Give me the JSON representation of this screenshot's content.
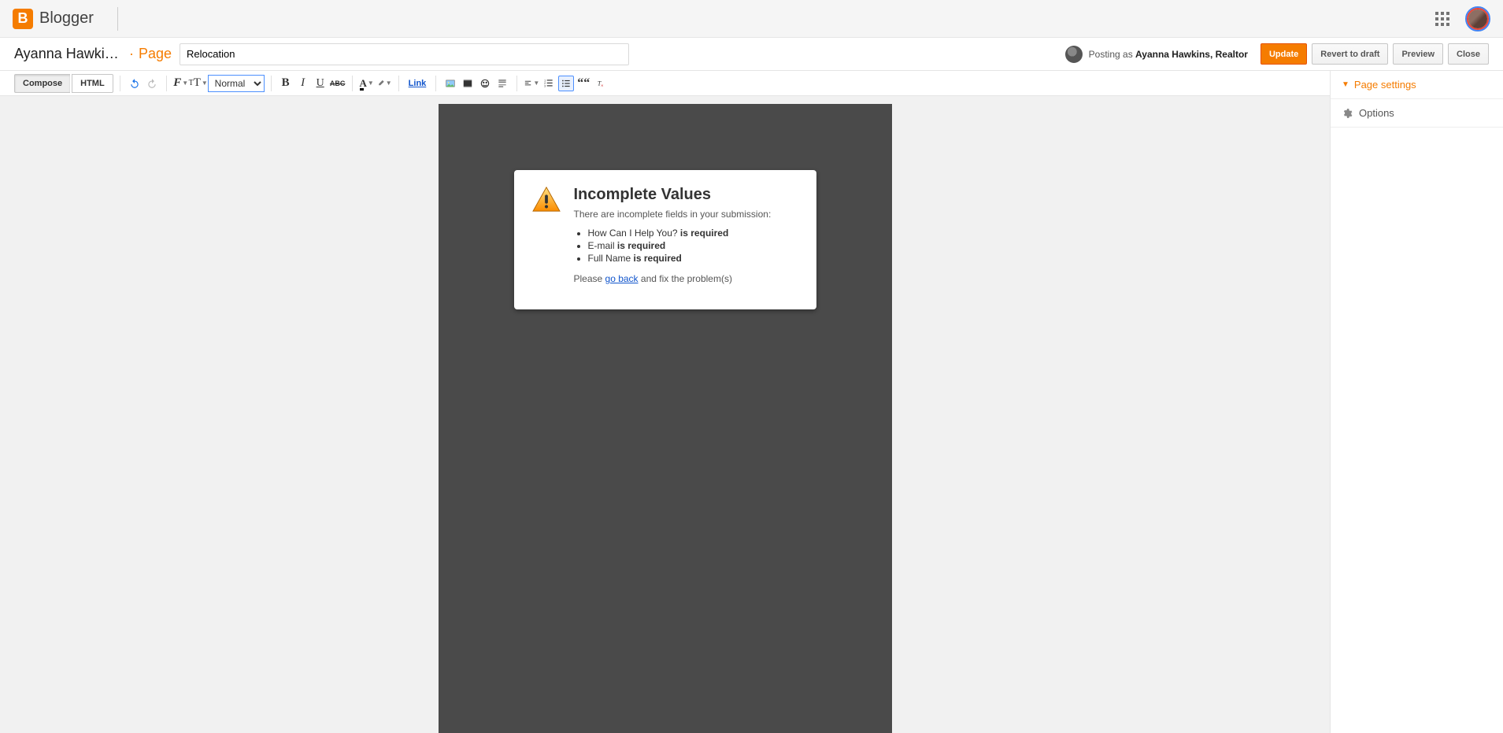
{
  "header": {
    "brand": "Blogger"
  },
  "subheader": {
    "blog_name": "Ayanna Hawkins, ...",
    "page_label": "Page",
    "title_value": "Relocation",
    "posting_prefix": "Posting as ",
    "posting_author": "Ayanna Hawkins, Realtor",
    "update_label": "Update",
    "revert_label": "Revert to draft",
    "preview_label": "Preview",
    "close_label": "Close"
  },
  "toolbar": {
    "compose_label": "Compose",
    "html_label": "HTML",
    "format_value": "Normal",
    "link_label": "Link"
  },
  "error_card": {
    "title": "Incomplete Values",
    "subtitle": "There are incomplete fields in your submission:",
    "items": [
      {
        "field": "How Can I Help You?",
        "msg": "is required"
      },
      {
        "field": "E-mail",
        "msg": "is required"
      },
      {
        "field": "Full Name",
        "msg": "is required"
      }
    ],
    "please_prefix": "Please ",
    "go_back": "go back",
    "please_suffix": " and fix the problem(s)"
  },
  "right_panel": {
    "settings_label": "Page settings",
    "options_label": "Options"
  }
}
